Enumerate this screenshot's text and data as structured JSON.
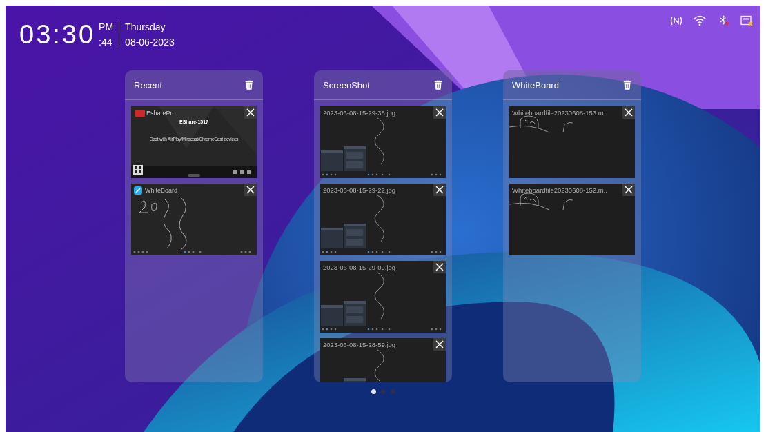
{
  "clock": {
    "time": "03:30",
    "meridiem": "PM",
    "seconds": ":44",
    "weekday": "Thursday",
    "date": "08-06-2023"
  },
  "status_icons": [
    {
      "kind": "nfc",
      "disabled": false
    },
    {
      "kind": "wifi",
      "disabled": false
    },
    {
      "kind": "bluetooth",
      "disabled": true
    },
    {
      "kind": "cast",
      "disabled": true
    }
  ],
  "panels": [
    {
      "title": "Recent",
      "items": [
        {
          "kind": "eshare",
          "app_name": "EsharePro",
          "device": "EShare-1517",
          "message": "Cast with AirPlay/Miracast/ChromeCast devices"
        },
        {
          "kind": "whiteboard_app",
          "app_name": "WhiteBoard"
        }
      ]
    },
    {
      "title": "ScreenShot",
      "items": [
        {
          "kind": "screenshot",
          "name": "2023-06-08-15-29-35.jpg"
        },
        {
          "kind": "screenshot",
          "name": "2023-06-08-15-29-22.jpg"
        },
        {
          "kind": "screenshot",
          "name": "2023-06-08-15-29-09.jpg"
        },
        {
          "kind": "screenshot",
          "name": "2023-06-08-15-28-59.jpg"
        }
      ]
    },
    {
      "title": "WhiteBoard",
      "items": [
        {
          "kind": "whiteboard_file",
          "name": "Whiteboardfile20230608-153.m.."
        },
        {
          "kind": "whiteboard_file",
          "name": "Whiteboardfile20230608-152.m.."
        }
      ]
    }
  ],
  "pages": [
    {
      "selected": true
    },
    {
      "selected": false
    },
    {
      "selected": false
    }
  ]
}
